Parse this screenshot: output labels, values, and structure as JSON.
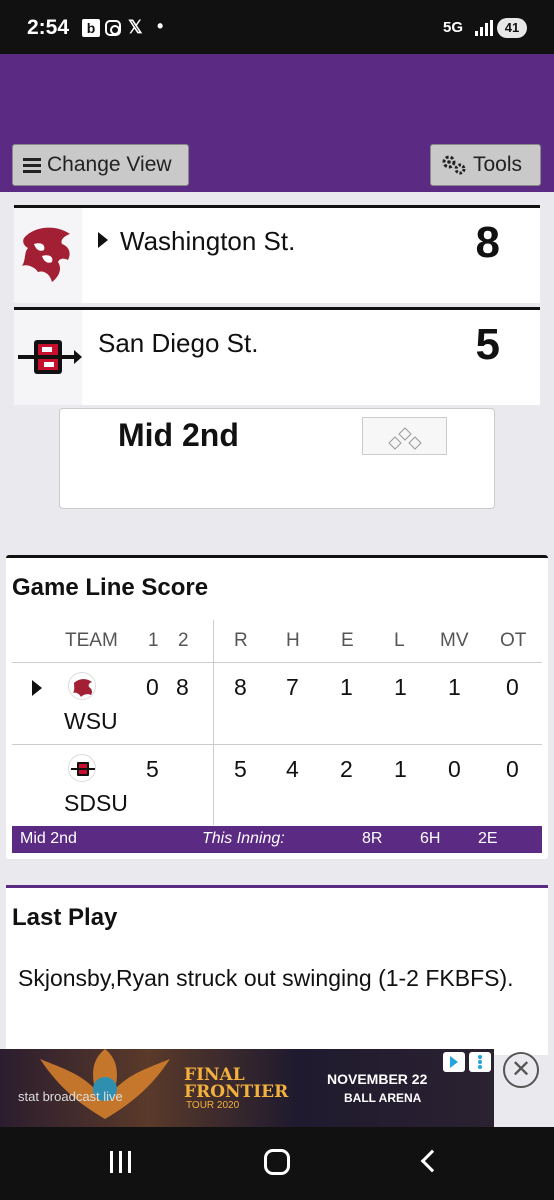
{
  "status_bar": {
    "time": "2:54",
    "network": "5G",
    "battery": "41"
  },
  "header": {
    "change_view_label": "Change View",
    "tools_label": "Tools"
  },
  "scoreboard": {
    "teams": [
      {
        "name": "Washington St.",
        "score": "8",
        "batting": true
      },
      {
        "name": "San Diego St.",
        "score": "5",
        "batting": false
      }
    ],
    "inning_status": "Mid 2nd"
  },
  "line_score": {
    "title": "Game Line Score",
    "headers": [
      "TEAM",
      "1",
      "2",
      "R",
      "H",
      "E",
      "L",
      "MV",
      "OT"
    ],
    "rows": [
      {
        "team": "WSU",
        "innings": [
          "0",
          "8"
        ],
        "R": "8",
        "H": "7",
        "E": "1",
        "L": "1",
        "MV": "1",
        "OT": "0"
      },
      {
        "team": "SDSU",
        "innings": [
          "5",
          ""
        ],
        "R": "5",
        "H": "4",
        "E": "2",
        "L": "1",
        "MV": "0",
        "OT": "0"
      }
    ],
    "footer": {
      "status": "Mid 2nd",
      "this_inning_label": "This Inning:",
      "runs": "8R",
      "hits": "6H",
      "errors": "2E"
    }
  },
  "last_play": {
    "title": "Last Play",
    "text": "Skjonsby,Ryan struck out swinging (1-2 FKBFS)."
  },
  "ad": {
    "brand": "stat broadcast live",
    "title_line1": "FINAL",
    "title_line2": "FRONTIER",
    "subtitle": "TOUR 2020",
    "date": "NOVEMBER 22",
    "venue": "BALL ARENA",
    "close": "✕"
  },
  "colors": {
    "purple": "#5b2a83",
    "wsu_crimson": "#a31f34",
    "sdsu_red": "#c8102e"
  }
}
